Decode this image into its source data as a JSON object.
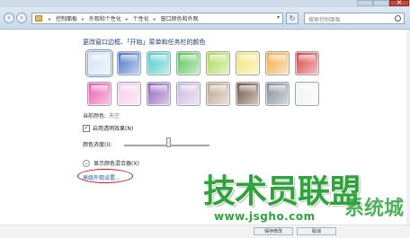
{
  "addressbar": {
    "crumbs": [
      "控制面板",
      "外观和个性化",
      "个性化",
      "窗口颜色和外观"
    ],
    "search_placeholder": "搜索控制面板"
  },
  "heading": "更改窗口边框、「开始」菜单和任务栏的颜色",
  "swatches": [
    {
      "name": "sky",
      "color": "#cfe3f6",
      "selected": true
    },
    {
      "name": "twilight",
      "color": "#3f6fc4"
    },
    {
      "name": "sea",
      "color": "#3fc9c6"
    },
    {
      "name": "leaf",
      "color": "#4fbf4f"
    },
    {
      "name": "lime",
      "color": "#a6d84a"
    },
    {
      "name": "lemon",
      "color": "#f2e36a"
    },
    {
      "name": "pumpkin",
      "color": "#f2a83a"
    },
    {
      "name": "ruby",
      "color": "#d6383a"
    },
    {
      "name": "fuchsia",
      "color": "#ec4fa8"
    },
    {
      "name": "blush",
      "color": "#f6c6e6"
    },
    {
      "name": "violet",
      "color": "#8a5bb8"
    },
    {
      "name": "lavender",
      "color": "#c8b4de"
    },
    {
      "name": "taupe",
      "color": "#b4a286"
    },
    {
      "name": "chocolate",
      "color": "#6a4a3a"
    },
    {
      "name": "slate",
      "color": "#7a8692"
    },
    {
      "name": "frost",
      "color": "#f2f2f2"
    }
  ],
  "current_color_label": "当前颜色:",
  "current_color_value": "天空",
  "transparency_label": "启用透明效果(N)",
  "transparency_checked": "✓",
  "intensity_label": "颜色浓度(I):",
  "intensity_level": 0.5,
  "mixer_label": "显示颜色混合器(X)",
  "advanced_label": "高级外观设置...",
  "watermark": {
    "brand": "技术员联盟",
    "suffix": "系统城",
    "url": "www.jsgho.com"
  },
  "buttons": {
    "save": "保存修改",
    "cancel": "取消"
  },
  "colors": {
    "link": "#1a56b0",
    "heading": "#1c3a6a",
    "watermark_green": "#2ea43a",
    "highlight_oval": "#c0151c"
  }
}
